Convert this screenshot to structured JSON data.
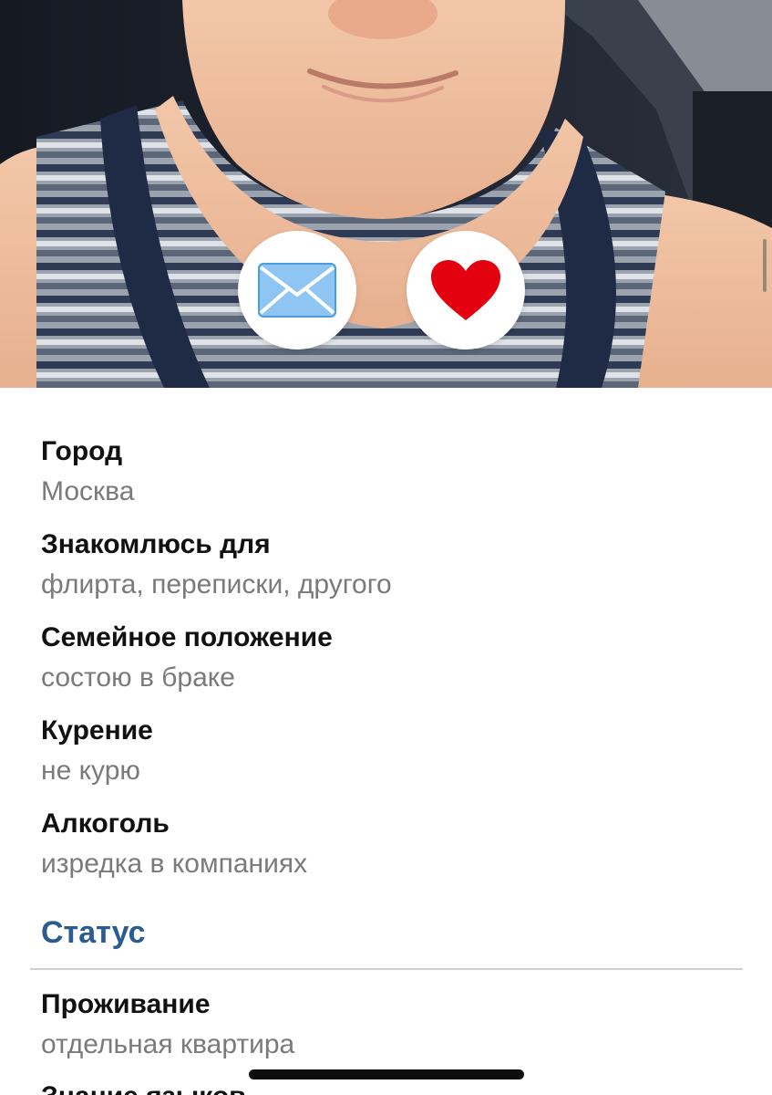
{
  "profile": {
    "photo": {
      "icon": "profile-photo",
      "actions": {
        "message": {
          "icon": "envelope-icon",
          "color": "#8ec5f2"
        },
        "like": {
          "icon": "heart-icon",
          "color": "#e3000f"
        }
      }
    },
    "fields": [
      {
        "label": "Город",
        "value": "Москва"
      },
      {
        "label": "Знакомлюсь для",
        "value": "флирта, переписки, другого"
      },
      {
        "label": "Семейное положение",
        "value": "состою в браке"
      },
      {
        "label": "Курение",
        "value": "не курю"
      },
      {
        "label": "Алкоголь",
        "value": "изредка в компаниях"
      }
    ],
    "status_section": {
      "title": "Статус",
      "title_color": "#2a5c92",
      "fields": [
        {
          "label": "Проживание",
          "value": "отдельная квартира"
        },
        {
          "label": "Знание языков",
          "value": ""
        }
      ]
    }
  }
}
